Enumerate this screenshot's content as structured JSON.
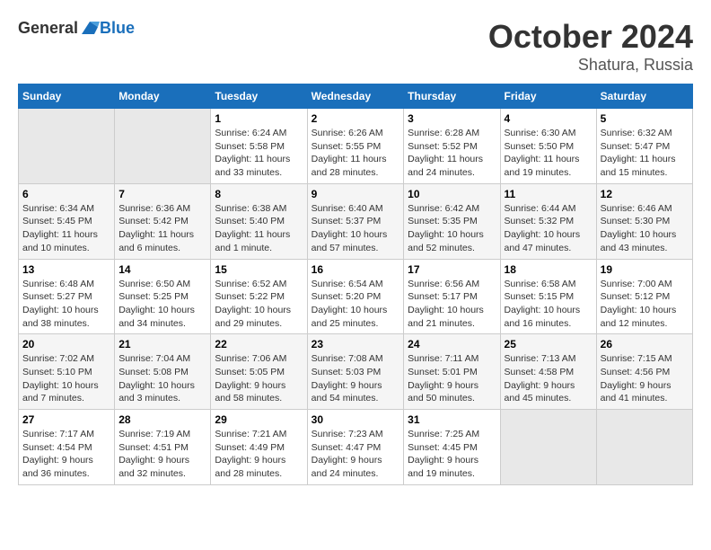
{
  "header": {
    "logo_general": "General",
    "logo_blue": "Blue",
    "title": "October 2024",
    "location": "Shatura, Russia"
  },
  "weekdays": [
    "Sunday",
    "Monday",
    "Tuesday",
    "Wednesday",
    "Thursday",
    "Friday",
    "Saturday"
  ],
  "weeks": [
    [
      {
        "day": "",
        "empty": true
      },
      {
        "day": "",
        "empty": true
      },
      {
        "day": "1",
        "sunrise": "6:24 AM",
        "sunset": "5:58 PM",
        "daylight": "11 hours and 33 minutes."
      },
      {
        "day": "2",
        "sunrise": "6:26 AM",
        "sunset": "5:55 PM",
        "daylight": "11 hours and 28 minutes."
      },
      {
        "day": "3",
        "sunrise": "6:28 AM",
        "sunset": "5:52 PM",
        "daylight": "11 hours and 24 minutes."
      },
      {
        "day": "4",
        "sunrise": "6:30 AM",
        "sunset": "5:50 PM",
        "daylight": "11 hours and 19 minutes."
      },
      {
        "day": "5",
        "sunrise": "6:32 AM",
        "sunset": "5:47 PM",
        "daylight": "11 hours and 15 minutes."
      }
    ],
    [
      {
        "day": "6",
        "sunrise": "6:34 AM",
        "sunset": "5:45 PM",
        "daylight": "11 hours and 10 minutes."
      },
      {
        "day": "7",
        "sunrise": "6:36 AM",
        "sunset": "5:42 PM",
        "daylight": "11 hours and 6 minutes."
      },
      {
        "day": "8",
        "sunrise": "6:38 AM",
        "sunset": "5:40 PM",
        "daylight": "11 hours and 1 minute."
      },
      {
        "day": "9",
        "sunrise": "6:40 AM",
        "sunset": "5:37 PM",
        "daylight": "10 hours and 57 minutes."
      },
      {
        "day": "10",
        "sunrise": "6:42 AM",
        "sunset": "5:35 PM",
        "daylight": "10 hours and 52 minutes."
      },
      {
        "day": "11",
        "sunrise": "6:44 AM",
        "sunset": "5:32 PM",
        "daylight": "10 hours and 47 minutes."
      },
      {
        "day": "12",
        "sunrise": "6:46 AM",
        "sunset": "5:30 PM",
        "daylight": "10 hours and 43 minutes."
      }
    ],
    [
      {
        "day": "13",
        "sunrise": "6:48 AM",
        "sunset": "5:27 PM",
        "daylight": "10 hours and 38 minutes."
      },
      {
        "day": "14",
        "sunrise": "6:50 AM",
        "sunset": "5:25 PM",
        "daylight": "10 hours and 34 minutes."
      },
      {
        "day": "15",
        "sunrise": "6:52 AM",
        "sunset": "5:22 PM",
        "daylight": "10 hours and 29 minutes."
      },
      {
        "day": "16",
        "sunrise": "6:54 AM",
        "sunset": "5:20 PM",
        "daylight": "10 hours and 25 minutes."
      },
      {
        "day": "17",
        "sunrise": "6:56 AM",
        "sunset": "5:17 PM",
        "daylight": "10 hours and 21 minutes."
      },
      {
        "day": "18",
        "sunrise": "6:58 AM",
        "sunset": "5:15 PM",
        "daylight": "10 hours and 16 minutes."
      },
      {
        "day": "19",
        "sunrise": "7:00 AM",
        "sunset": "5:12 PM",
        "daylight": "10 hours and 12 minutes."
      }
    ],
    [
      {
        "day": "20",
        "sunrise": "7:02 AM",
        "sunset": "5:10 PM",
        "daylight": "10 hours and 7 minutes."
      },
      {
        "day": "21",
        "sunrise": "7:04 AM",
        "sunset": "5:08 PM",
        "daylight": "10 hours and 3 minutes."
      },
      {
        "day": "22",
        "sunrise": "7:06 AM",
        "sunset": "5:05 PM",
        "daylight": "9 hours and 58 minutes."
      },
      {
        "day": "23",
        "sunrise": "7:08 AM",
        "sunset": "5:03 PM",
        "daylight": "9 hours and 54 minutes."
      },
      {
        "day": "24",
        "sunrise": "7:11 AM",
        "sunset": "5:01 PM",
        "daylight": "9 hours and 50 minutes."
      },
      {
        "day": "25",
        "sunrise": "7:13 AM",
        "sunset": "4:58 PM",
        "daylight": "9 hours and 45 minutes."
      },
      {
        "day": "26",
        "sunrise": "7:15 AM",
        "sunset": "4:56 PM",
        "daylight": "9 hours and 41 minutes."
      }
    ],
    [
      {
        "day": "27",
        "sunrise": "7:17 AM",
        "sunset": "4:54 PM",
        "daylight": "9 hours and 36 minutes."
      },
      {
        "day": "28",
        "sunrise": "7:19 AM",
        "sunset": "4:51 PM",
        "daylight": "9 hours and 32 minutes."
      },
      {
        "day": "29",
        "sunrise": "7:21 AM",
        "sunset": "4:49 PM",
        "daylight": "9 hours and 28 minutes."
      },
      {
        "day": "30",
        "sunrise": "7:23 AM",
        "sunset": "4:47 PM",
        "daylight": "9 hours and 24 minutes."
      },
      {
        "day": "31",
        "sunrise": "7:25 AM",
        "sunset": "4:45 PM",
        "daylight": "9 hours and 19 minutes."
      },
      {
        "day": "",
        "empty": true
      },
      {
        "day": "",
        "empty": true
      }
    ]
  ]
}
